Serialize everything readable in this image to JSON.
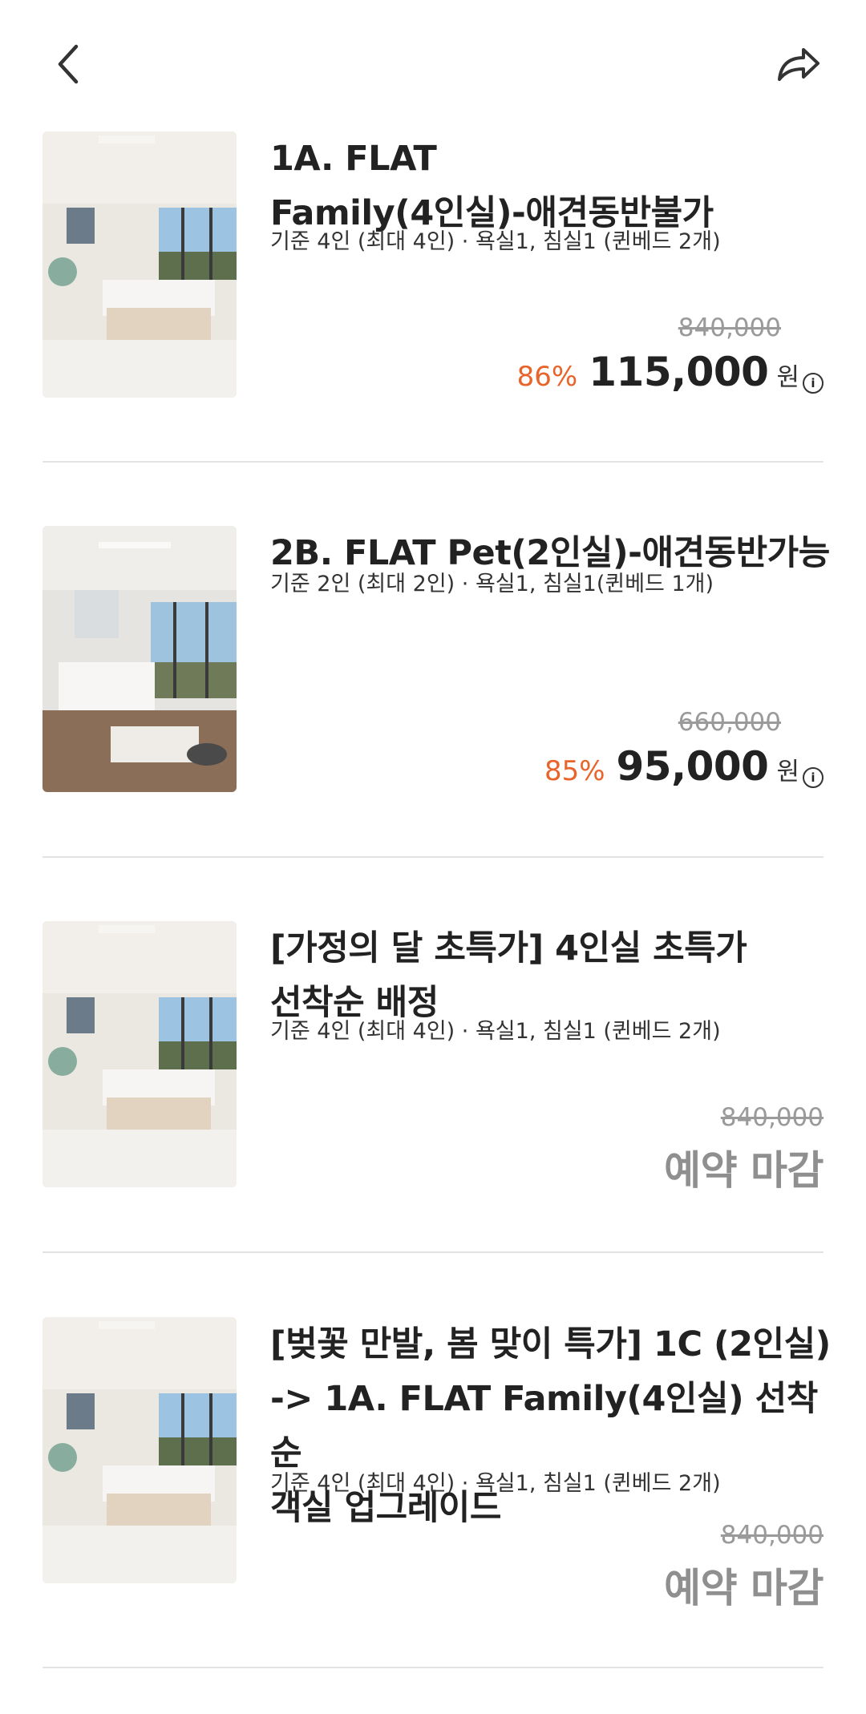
{
  "header": {
    "back_icon": "chevron-left-icon",
    "share_icon": "share-arrow-icon"
  },
  "rooms": [
    {
      "title": "1A. FLAT\nFamily(4인실)-애견동반불가",
      "desc": "기준 4인 (최대 4인) · 욕실1, 침실1 (퀸베드 2개)",
      "original_price": "840,000",
      "discount": "86%",
      "price": "115,000",
      "unit": "원",
      "status": ""
    },
    {
      "title": "2B. FLAT Pet(2인실)-애견동반가능",
      "desc": "기준 2인 (최대 2인) · 욕실1, 침실1(퀸베드 1개)",
      "original_price": "660,000",
      "discount": "85%",
      "price": "95,000",
      "unit": "원",
      "status": ""
    },
    {
      "title": "[가정의 달 초특가] 4인실 초특가\n선착순 배정",
      "desc": "기준 4인 (최대 4인) · 욕실1, 침실1 (퀸베드 2개)",
      "original_price": "840,000",
      "discount": "",
      "price": "",
      "unit": "",
      "status": "예약 마감"
    },
    {
      "title": "[벚꽃 만발, 봄 맞이 특가] 1C (2인실)\n-> 1A. FLAT Family(4인실) 선착순\n객실 업그레이드",
      "desc": "기준 4인 (최대 4인) · 욕실1, 침실1 (퀸베드 2개)",
      "original_price": "840,000",
      "discount": "",
      "price": "",
      "unit": "",
      "status": "예약 마감"
    }
  ],
  "colors": {
    "discount": "#e8642a",
    "soldout": "#8f8f8f",
    "strike": "#9a9a9a",
    "divider": "#e2e2e2"
  }
}
